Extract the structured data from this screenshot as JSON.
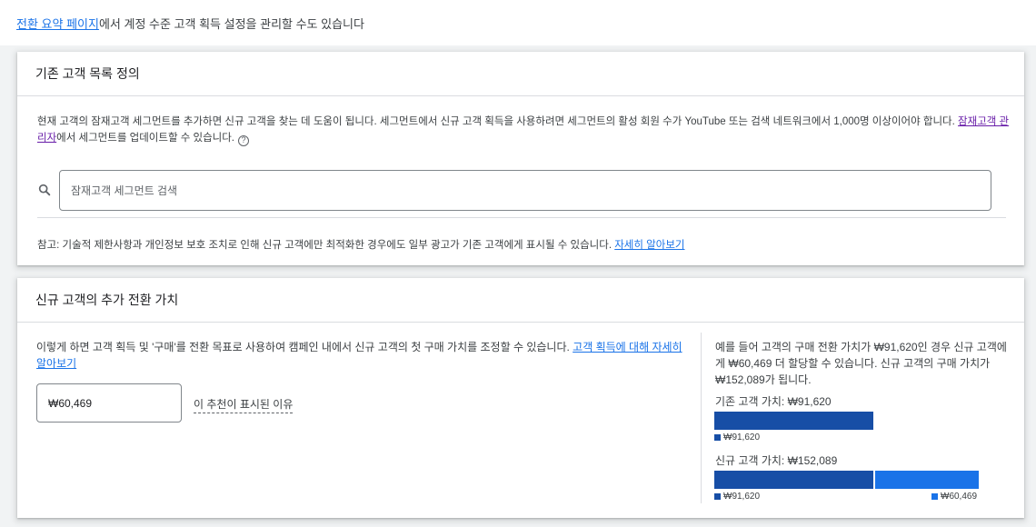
{
  "top_line": {
    "link": "전환 요약 페이지",
    "text": "에서 계정 수준 고객 획득 설정을 관리할 수도 있습니다"
  },
  "existing_customers": {
    "title": "기존 고객 목록 정의",
    "description_1": "현재 고객의 잠재고객 세그먼트를 추가하면 신규 고객을 찾는 데 도움이 됩니다. 세그먼트에서 신규 고객 획득을 사용하려면 세그먼트의 활성 회원 수가 YouTube 또는 검색 네트워크에서 1,000명 이상이어야 합니다. ",
    "audience_manager_link": "잠재고객 관리자",
    "description_2": "에서 세그먼트를 업데이트할 수 있습니다.",
    "help_icon": "question-circle-icon",
    "search_icon": "search-icon",
    "search_placeholder": "잠재고객 세그먼트 검색",
    "note": "참고: 기술적 제한사항과 개인정보 보호 조치로 인해 신규 고객에만 최적화한 경우에도 일부 광고가 기존 고객에게 표시될 수 있습니다. ",
    "note_link": "자세히 알아보기"
  },
  "new_customer_value": {
    "title": "신규 고객의 추가 전환 가치",
    "description": "이렇게 하면 고객 획득 및 '구매'를 전환 목표로 사용하여 캠페인 내에서 신규 고객의 첫 구매 가치를 조정할 수 있습니다. ",
    "description_link": "고객 획득에 대해 자세히 알아보기",
    "value": "₩60,469",
    "why_link": "이 추천이 표시된 이유",
    "example": "예를 들어 고객의 구매 전환 가치가 ₩91,620인 경우 신규 고객에게 ₩60,469 더 할당할 수 있습니다. 신규 고객의 구매 가치가 ₩152,089가 됩니다.",
    "existing_label": "기존 고객 가치: ₩91,620",
    "new_label": "신규 고객 가치: ₩152,089",
    "base_legend": "₩91,620",
    "extra_legend": "₩60,469",
    "base_amount": 91620,
    "extra_amount": 60469,
    "colors": {
      "base": "#174ea6",
      "extra": "#1a73e8"
    }
  }
}
